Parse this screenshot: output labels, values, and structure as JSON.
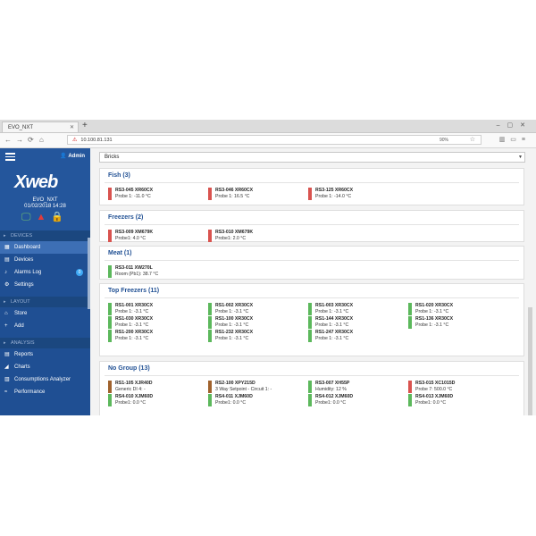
{
  "browser": {
    "tab_title": "EVO_NXT",
    "url": "10.100.81.131",
    "zoom": "90%"
  },
  "sidebar": {
    "admin_label": "Admin",
    "logo": "Xweb",
    "device_name": "EVO_NXT",
    "device_datetime": "01/02/2018 14:28",
    "sections": [
      {
        "label": "DEVICES",
        "items": [
          {
            "label": "Dashboard",
            "icon": "dashboard-icon",
            "active": true
          },
          {
            "label": "Devices",
            "icon": "devices-icon"
          },
          {
            "label": "Alarms Log",
            "icon": "bell-icon",
            "badge": "0"
          },
          {
            "label": "Settings",
            "icon": "gear-icon"
          }
        ]
      },
      {
        "label": "LAYOUT",
        "items": [
          {
            "label": "Store",
            "icon": "store-icon"
          },
          {
            "label": "Add",
            "icon": "plus-icon"
          }
        ]
      },
      {
        "label": "ANALYSIS",
        "items": [
          {
            "label": "Reports",
            "icon": "reports-icon"
          },
          {
            "label": "Charts",
            "icon": "chart-icon"
          },
          {
            "label": "Consumptions Analyzer",
            "icon": "analyzer-icon"
          },
          {
            "label": "Performance",
            "icon": "performance-icon"
          }
        ]
      }
    ]
  },
  "main": {
    "filter_value": "Bricks",
    "colors": {
      "green": "#5cb85c",
      "red": "#d9534f",
      "brown": "#a0622d"
    },
    "groups": [
      {
        "title": "Fish (3)",
        "devices": [
          {
            "name": "RS3-045 XR60CX",
            "value": "Probe 1: -11.0 °C",
            "status": "red"
          },
          {
            "name": "RS3-046 XR60CX",
            "value": "Probe 1: 16.5 °C",
            "status": "red"
          },
          {
            "name": "RS3-125 XR60CX",
            "value": "Probe 1: -14.0 °C",
            "status": "red"
          }
        ]
      },
      {
        "title": "Freezers (2)",
        "devices": [
          {
            "name": "RS3-009 XM679K",
            "value": "Probe1: 4.0 °C",
            "status": "red"
          },
          {
            "name": "RS3-010 XM679K",
            "value": "Probe1: 2.0 °C",
            "status": "red"
          }
        ]
      },
      {
        "title": "Meat (1)",
        "devices": [
          {
            "name": "RS3-011 XW270L",
            "value": "Room (Pb1): 38.7 °C",
            "status": "green"
          }
        ]
      },
      {
        "title": "Top Freezers (11)",
        "devices": [
          {
            "name": "RS1-001 XR30CX",
            "value": "Probe 1: -3.1 °C",
            "status": "green"
          },
          {
            "name": "RS1-002 XR30CX",
            "value": "Probe 1: -3.1 °C",
            "status": "green"
          },
          {
            "name": "RS1-003 XR30CX",
            "value": "Probe 1: -3.1 °C",
            "status": "green"
          },
          {
            "name": "RS1-020 XR30CX",
            "value": "Probe 1: -3.1 °C",
            "status": "green"
          },
          {
            "name": "RS1-030 XR30CX",
            "value": "Probe 1: -3.1 °C",
            "status": "green"
          },
          {
            "name": "RS1-100 XR30CX",
            "value": "Probe 1: -3.1 °C",
            "status": "green"
          },
          {
            "name": "RS1-144 XR30CX",
            "value": "Probe 1: -3.1 °C",
            "status": "green"
          },
          {
            "name": "RS1-136 XR30CX",
            "value": "Probe 1: -3.1 °C",
            "status": "green"
          },
          {
            "name": "RS1-200 XR30CX",
            "value": "Probe 1: -3.1 °C",
            "status": "green"
          },
          {
            "name": "RS1-232 XR30CX",
            "value": "Probe 1: -3.1 °C",
            "status": "green"
          },
          {
            "name": "RS1-247 XR30CX",
            "value": "Probe 1: -3.1 °C",
            "status": "green"
          }
        ]
      },
      {
        "title": "No Group (13)",
        "devices": [
          {
            "name": "RS1-105 XJR40D",
            "value": "Generic DI 4: -",
            "status": "brown"
          },
          {
            "name": "RS2-100 XPY215D",
            "value": "3 Way Setpoint - Circuit 1: -",
            "status": "brown"
          },
          {
            "name": "RS3-007 XH55P",
            "value": "Humidity: 12 %",
            "status": "green"
          },
          {
            "name": "RS3-015 XC1015D",
            "value": "Probe 7: 500.0 °C",
            "status": "red"
          },
          {
            "name": "RS4-010 XJM60D",
            "value": "Probe1: 0.0 °C",
            "status": "green"
          },
          {
            "name": "RS4-011 XJM60D",
            "value": "Probe1: 0.0 °C",
            "status": "green"
          },
          {
            "name": "RS4-012 XJM60D",
            "value": "Probe1: 0.0 °C",
            "status": "green"
          },
          {
            "name": "RS4-013 XJM60D",
            "value": "Probe1: 0.0 °C",
            "status": "green"
          }
        ]
      }
    ]
  }
}
